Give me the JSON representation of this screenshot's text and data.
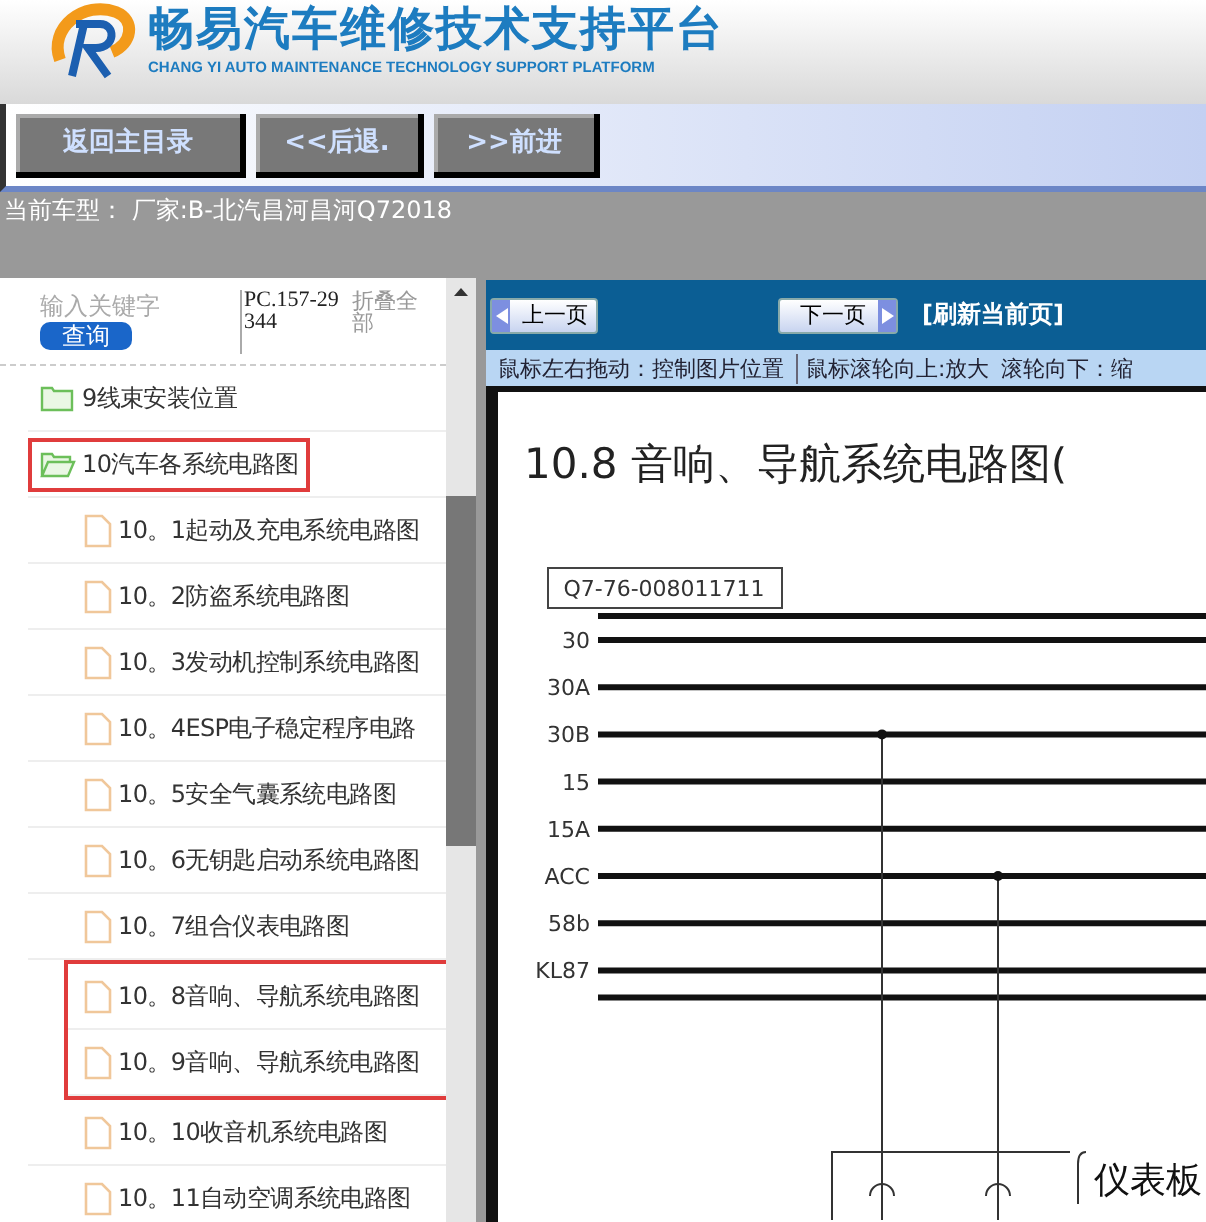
{
  "header": {
    "title": "畅易汽车维修技术支持平台",
    "subtitle": "CHANG YI AUTO MAINTENANCE TECHNOLOGY SUPPORT PLATFORM"
  },
  "nav_buttons": [
    "返回主目录",
    "<<后退.",
    ">>前进"
  ],
  "current_vehicle": "当前车型：  厂家:B-北汽昌河昌河Q72018",
  "sidebar": {
    "search": {
      "placeholder": "输入关键字"
    },
    "search_button": "查询",
    "code": "PC.157-29344",
    "collapse_all": "折叠全部",
    "tree": [
      {
        "label": "9线束安装位置",
        "kind": "folder",
        "expanded": false,
        "highlighted": false
      },
      {
        "label": "10汽车各系统电路图",
        "kind": "folder",
        "expanded": true,
        "highlighted": true,
        "children": [
          {
            "label": "10。1起动及充电系统电路图",
            "kind": "file",
            "highlighted": false
          },
          {
            "label": "10。2防盗系统电路图",
            "kind": "file",
            "highlighted": false
          },
          {
            "label": "10。3发动机控制系统电路图",
            "kind": "file",
            "highlighted": false
          },
          {
            "label": "10。4ESP电子稳定程序电路",
            "kind": "file",
            "highlighted": false
          },
          {
            "label": "10。5安全气囊系统电路图",
            "kind": "file",
            "highlighted": false
          },
          {
            "label": "10。6无钥匙启动系统电路图",
            "kind": "file",
            "highlighted": false
          },
          {
            "label": "10。7组合仪表电路图",
            "kind": "file",
            "highlighted": false
          },
          {
            "label": "10。8音响、导航系统电路图",
            "kind": "file",
            "highlighted": true
          },
          {
            "label": "10。9音响、导航系统电路图",
            "kind": "file",
            "highlighted": true
          },
          {
            "label": "10。10收音机系统电路图",
            "kind": "file",
            "highlighted": false
          },
          {
            "label": "10。11自动空调系统电路图",
            "kind": "file",
            "highlighted": false
          }
        ]
      }
    ]
  },
  "viewer": {
    "prev_button": "上一页",
    "next_button": "下一页",
    "refresh_link": "[刷新当前页]",
    "hints": [
      "鼠标左右拖动：控制图片位置",
      "鼠标滚轮向上:放大",
      "滚轮向下：缩"
    ],
    "document": {
      "title": "10.8 音响、导航系统电路图(",
      "part_number": "Q7-76-008011711",
      "rails": [
        "30",
        "30A",
        "30B",
        "15",
        "15A",
        "ACC",
        "58b",
        "KL87"
      ],
      "component_label": "仪表板"
    }
  }
}
